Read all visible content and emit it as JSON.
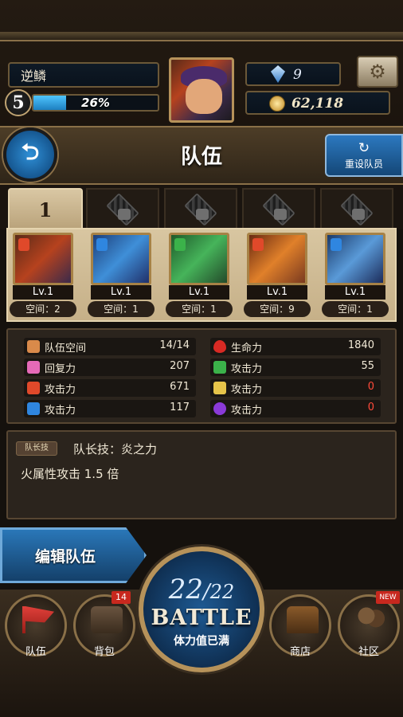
{
  "header": {
    "player_name": "逆鳞",
    "player_level": "5",
    "exp_percent_text": "26%",
    "exp_fraction": 0.26,
    "gems": "9",
    "coins": "62,118"
  },
  "title_bar": {
    "title": "队伍",
    "back_icon": "back-arrow-icon",
    "reset_icon": "refresh-icon",
    "reset_label": "重设队员"
  },
  "team_tabs": [
    {
      "label": "1",
      "locked": false
    },
    {
      "label": "",
      "locked": true
    },
    {
      "label": "",
      "locked": true
    },
    {
      "label": "",
      "locked": true
    },
    {
      "label": "",
      "locked": true
    }
  ],
  "members": [
    {
      "level": "Lv.1",
      "space": "空间：2",
      "element": "fire",
      "color": "#c9441d"
    },
    {
      "level": "Lv.1",
      "space": "空间：1",
      "element": "water",
      "color": "#2a6fc2"
    },
    {
      "level": "Lv.1",
      "space": "空间：1",
      "element": "wood",
      "color": "#2f9a3c"
    },
    {
      "level": "Lv.1",
      "space": "空间：9",
      "element": "fire",
      "color": "#d9651f"
    },
    {
      "level": "Lv.1",
      "space": "空间：1",
      "element": "water",
      "color": "#2a5fb0"
    }
  ],
  "stats": {
    "left": [
      {
        "label": "队伍空间",
        "value": "14/14",
        "icon": "flag-icon"
      },
      {
        "label": "回复力",
        "value": "207",
        "icon": "heart-icon"
      },
      {
        "label": "攻击力",
        "value": "671",
        "icon": "fire-icon"
      },
      {
        "label": "攻击力",
        "value": "117",
        "icon": "water-icon"
      }
    ],
    "right": [
      {
        "label": "生命力",
        "value": "1840",
        "icon": "blood-drop-icon"
      },
      {
        "label": "攻击力",
        "value": "55",
        "icon": "leaf-icon"
      },
      {
        "label": "攻击力",
        "value": "0",
        "icon": "light-icon"
      },
      {
        "label": "攻击力",
        "value": "0",
        "icon": "dark-moon-icon"
      }
    ]
  },
  "leader_skill": {
    "tag": "队长技",
    "name": "队长技：炎之力",
    "description": "火属性攻击 1.5 倍"
  },
  "edit_team_label": "编辑队伍",
  "battle": {
    "stamina_current": "22",
    "stamina_separator": "/",
    "stamina_max": "22",
    "label": "BATTLE",
    "status": "体力值已满"
  },
  "nav": {
    "team_label": "队伍",
    "bag_label": "背包",
    "bag_badge": "14",
    "shop_label": "商店",
    "community_label": "社区",
    "community_badge": "NEW"
  },
  "colors": {
    "accent_blue": "#2a77b8",
    "frame_gold": "#b6925a",
    "alert_red": "#c8281e"
  }
}
